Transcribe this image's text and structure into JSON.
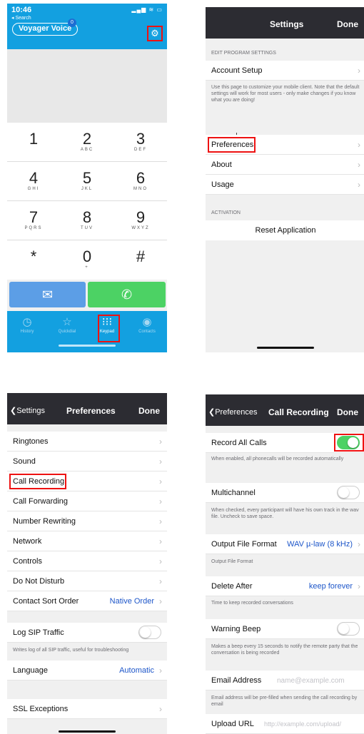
{
  "keypad_screen": {
    "status": {
      "time": "10:46",
      "back": "◂ Search",
      "icons": "▂▄▆ ≋ ▭"
    },
    "brand": "Voyager Voice",
    "badge": "0",
    "keys": [
      {
        "digit": "1",
        "letters": ""
      },
      {
        "digit": "2",
        "letters": "ABC"
      },
      {
        "digit": "3",
        "letters": "DEF"
      },
      {
        "digit": "4",
        "letters": "GHI"
      },
      {
        "digit": "5",
        "letters": "JKL"
      },
      {
        "digit": "6",
        "letters": "MNO"
      },
      {
        "digit": "7",
        "letters": "PQRS"
      },
      {
        "digit": "8",
        "letters": "TUV"
      },
      {
        "digit": "9",
        "letters": "WXYZ"
      },
      {
        "digit": "*",
        "letters": ""
      },
      {
        "digit": "0",
        "letters": "+"
      },
      {
        "digit": "#",
        "letters": ""
      }
    ],
    "tabs": [
      "History",
      "Quickdial",
      "Keypad",
      "Contacts"
    ]
  },
  "settings_screen": {
    "title": "Settings",
    "done": "Done",
    "section_edit": "EDIT PROGRAM SETTINGS",
    "account_setup": "Account Setup",
    "account_note": "Use this page to customize your mobile client. Note that the default settings will work for most users - only make changes if you know what you are doing!",
    "preferences": "Preferences",
    "about": "About",
    "usage": "Usage",
    "section_activation": "ACTIVATION",
    "reset": "Reset Application"
  },
  "preferences_screen": {
    "back": "Settings",
    "title": "Preferences",
    "done": "Done",
    "rows": [
      "Ringtones",
      "Sound",
      "Call Recording",
      "Call Forwarding",
      "Number Rewriting",
      "Network",
      "Controls",
      "Do Not Disturb"
    ],
    "contact_sort": {
      "label": "Contact Sort Order",
      "value": "Native Order"
    },
    "log_sip": "Log SIP Traffic",
    "log_sip_note": "Writes log of all SIP traffic, useful for troubleshooting",
    "language": {
      "label": "Language",
      "value": "Automatic"
    },
    "ssl": "SSL Exceptions"
  },
  "call_recording_screen": {
    "back": "Preferences",
    "title": "Call Recording",
    "done": "Done",
    "record_all": "Record All Calls",
    "record_all_on": true,
    "record_all_note": "When enabled, all phonecalls will be recorded automatically",
    "multichannel": "Multichannel",
    "multichannel_note": "When checked, every participant will have his own track in the wav file. Uncheck to save space.",
    "output_format": {
      "label": "Output File Format",
      "value": "WAV µ-law (8 kHz)"
    },
    "output_format_note": "Output File Format",
    "delete_after": {
      "label": "Delete After",
      "value": "keep forever"
    },
    "delete_after_note": "Time to keep recorded conversations",
    "warning_beep": "Warning Beep",
    "warning_beep_note": "Makes a beep every 15 seconds to notify the remote party that the conversation is being recorded",
    "email": {
      "label": "Email Address",
      "placeholder": "name@example.com"
    },
    "email_note": "Email address will be pre-filled when sending the call recording by email",
    "upload": {
      "label": "Upload URL",
      "placeholder": "http://example.com/upload/"
    }
  },
  "colors": {
    "brand_blue": "#13a0e0",
    "nav_dark": "#2c2c32",
    "toggle_green": "#4cd264",
    "highlight_red": "#e11111",
    "link_blue": "#1d56c9"
  }
}
